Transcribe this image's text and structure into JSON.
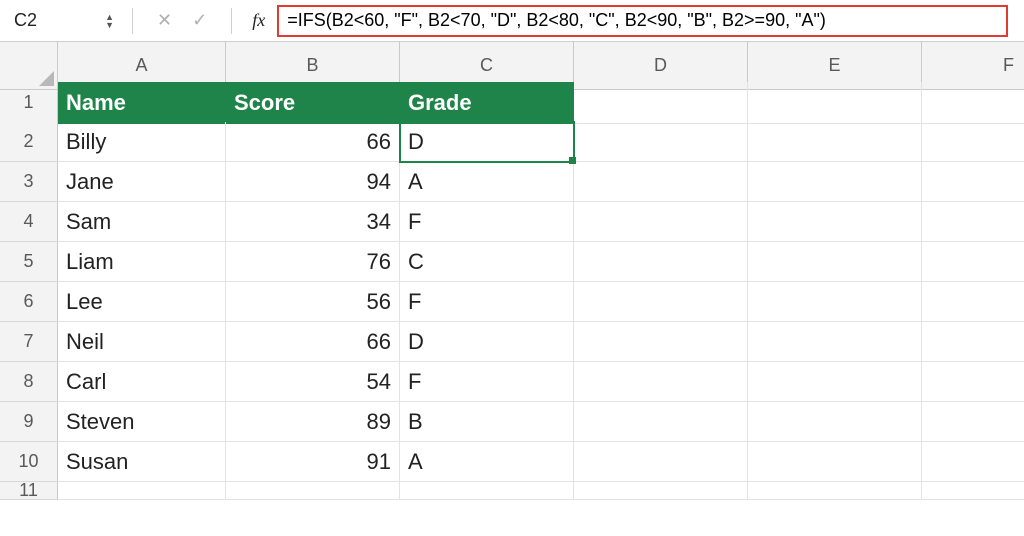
{
  "formula_bar": {
    "cell_ref": "C2",
    "fx_label": "fx",
    "formula": "=IFS(B2<60, \"F\", B2<70, \"D\", B2<80, \"C\", B2<90, \"B\", B2>=90, \"A\")"
  },
  "columns": [
    "A",
    "B",
    "C",
    "D",
    "E",
    "F"
  ],
  "headers": {
    "A": "Name",
    "B": "Score",
    "C": "Grade"
  },
  "rows": [
    {
      "n": "1"
    },
    {
      "n": "2",
      "A": "Billy",
      "B": "66",
      "C": "D"
    },
    {
      "n": "3",
      "A": "Jane",
      "B": "94",
      "C": "A"
    },
    {
      "n": "4",
      "A": "Sam",
      "B": "34",
      "C": "F"
    },
    {
      "n": "5",
      "A": "Liam",
      "B": "76",
      "C": "C"
    },
    {
      "n": "6",
      "A": "Lee",
      "B": "56",
      "C": "F"
    },
    {
      "n": "7",
      "A": "Neil",
      "B": "66",
      "C": "D"
    },
    {
      "n": "8",
      "A": "Carl",
      "B": "54",
      "C": "F"
    },
    {
      "n": "9",
      "A": "Steven",
      "B": "89",
      "C": "B"
    },
    {
      "n": "10",
      "A": "Susan",
      "B": "91",
      "C": "A"
    },
    {
      "n": "11"
    }
  ],
  "selected": "C2"
}
